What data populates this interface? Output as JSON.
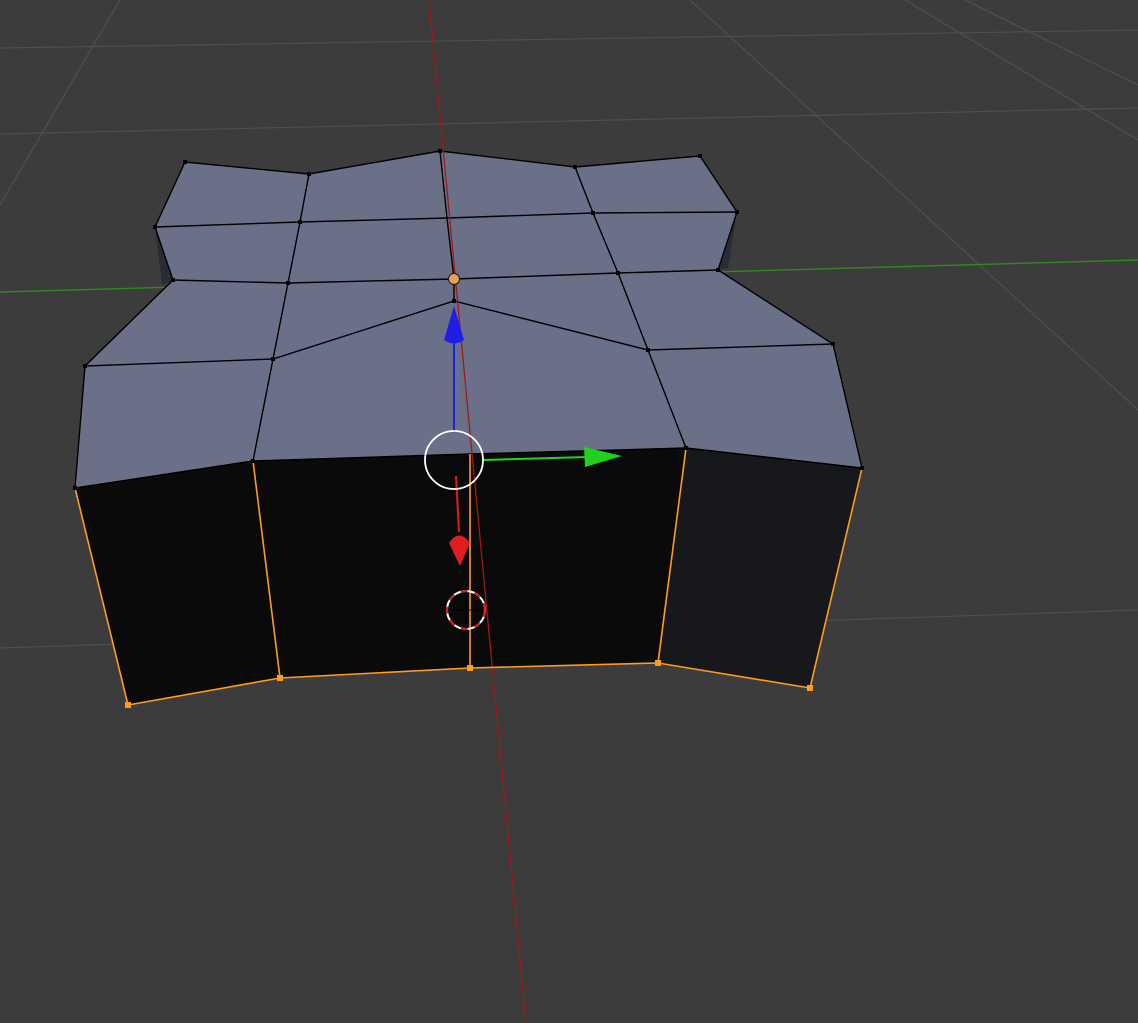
{
  "viewport": {
    "mode": "edit-mode",
    "background_color": "#3c3c3c",
    "grid_color": "#4f4f4f",
    "axis_x_color": "#a01818",
    "axis_y_color": "#2e8a1e",
    "mesh_top_color": "#6b7089",
    "mesh_side_color": "#0a0a0a",
    "mesh_side_right_color": "#17181c",
    "wire_color": "#000000",
    "selected_color": "#ff9c1e",
    "active_vertex_color": "#e8a058"
  },
  "gizmo": {
    "x_arrow_color": "#e01e1e",
    "y_arrow_color": "#1ed21e",
    "z_arrow_color": "#1e1ee6",
    "center_ring_color": "#ffffff"
  },
  "cursor_3d": {
    "ring_color_a": "#ffffff",
    "ring_color_b": "#d21e1e"
  }
}
